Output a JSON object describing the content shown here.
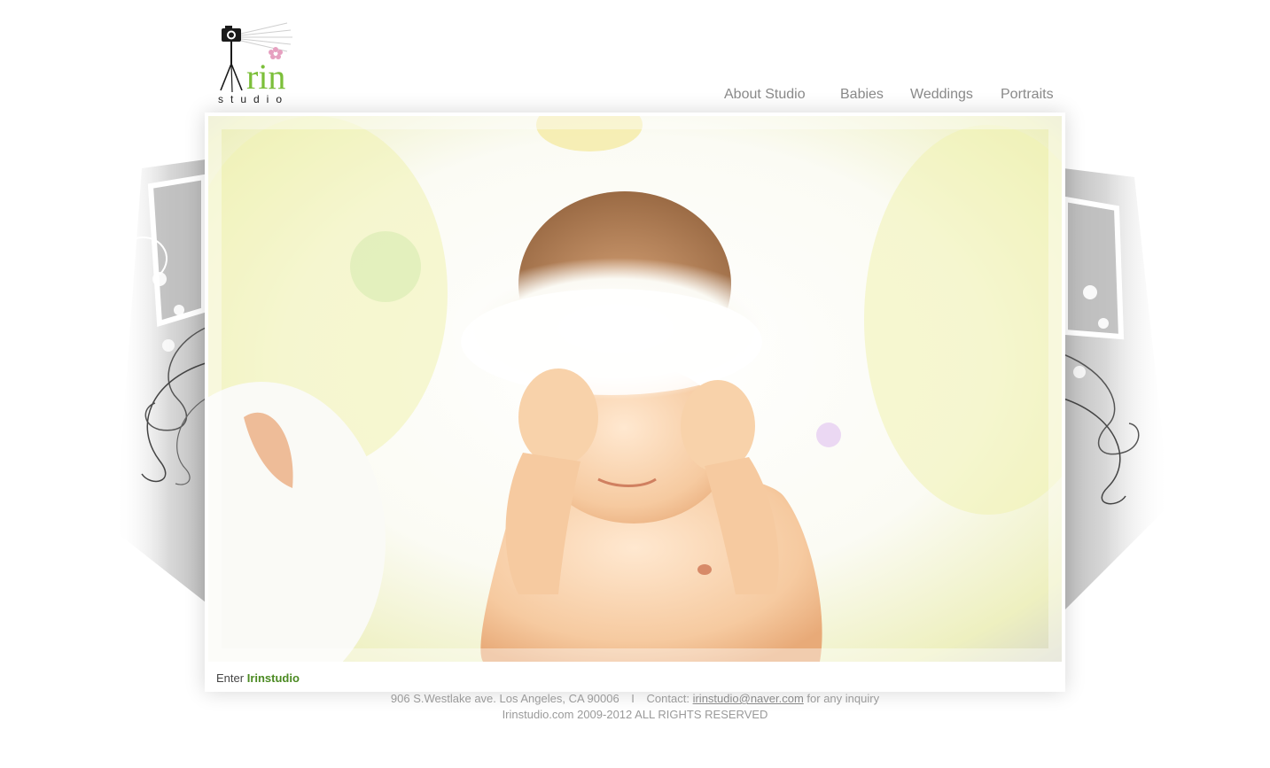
{
  "header": {
    "logo_text": "rin",
    "logo_subtext": "studio"
  },
  "nav": {
    "items": [
      {
        "label": "About Studio"
      },
      {
        "label": "Babies"
      },
      {
        "label": "Weddings"
      },
      {
        "label": "Portraits"
      }
    ]
  },
  "main": {
    "enter_prefix": "Enter",
    "enter_brand": "Irinstudio"
  },
  "footer": {
    "address": "906 S.Westlake ave. Los Angeles, CA 90006",
    "separator": "I",
    "contact_label": "Contact:",
    "email": "irinstudio@naver.com",
    "contact_suffix": "for any inquiry",
    "copyright": "Irinstudio.com 2009-2012 ALL RIGHTS RESERVED"
  },
  "colors": {
    "brand_green": "#4b8a22",
    "nav_gray": "#8a8a8a",
    "footer_gray": "#9a9a9a"
  }
}
